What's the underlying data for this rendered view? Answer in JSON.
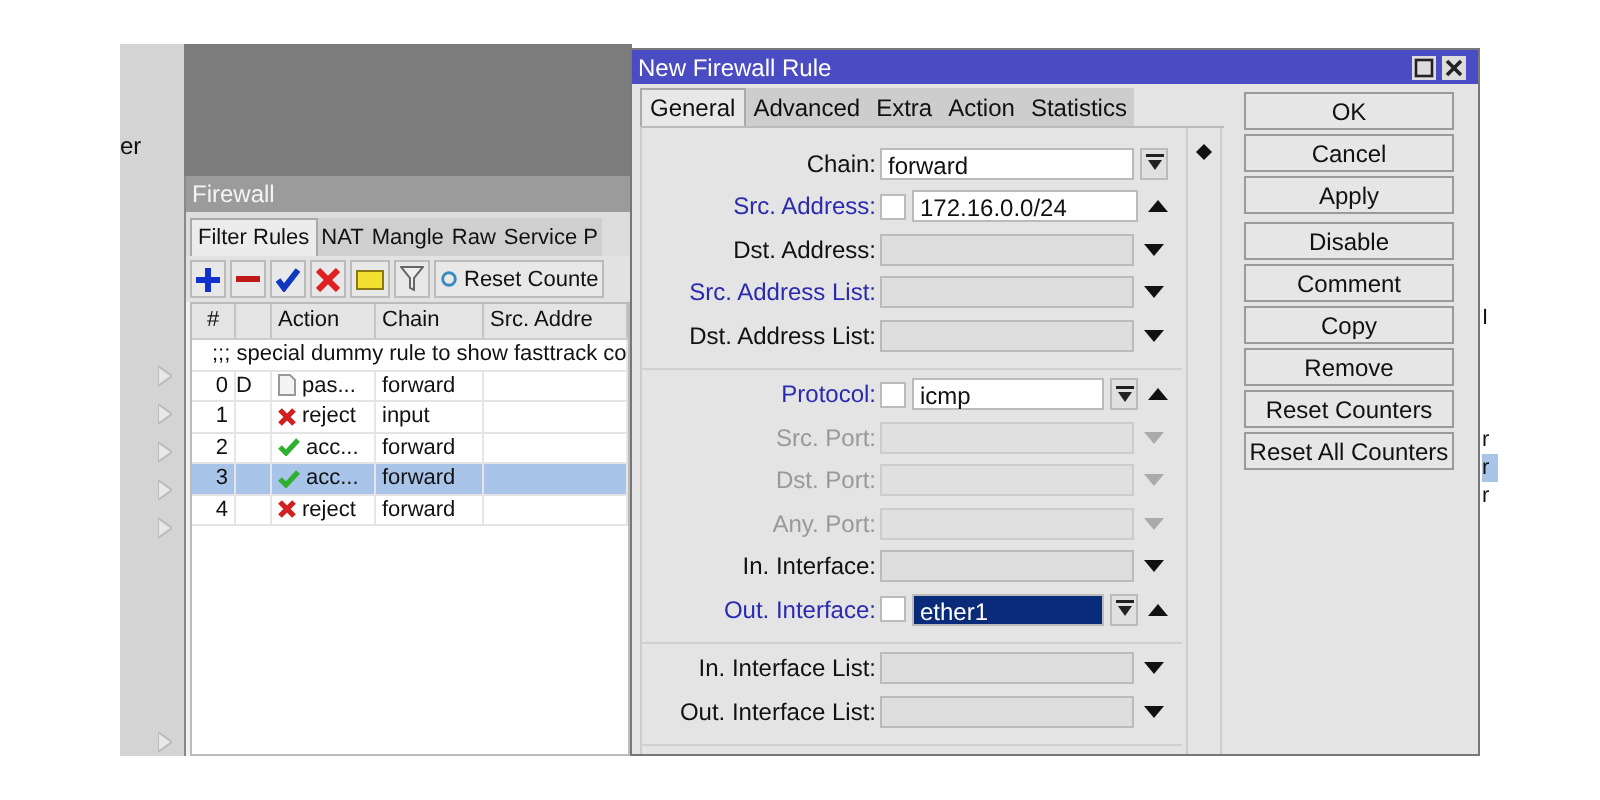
{
  "sidebar": {
    "label": "er"
  },
  "firewall": {
    "title": "Firewall",
    "tabs": [
      {
        "label": "Filter Rules",
        "selected": true
      },
      {
        "label": "NAT",
        "selected": false
      },
      {
        "label": "Mangle",
        "selected": false
      },
      {
        "label": "Raw",
        "selected": false
      },
      {
        "label": "Service P",
        "selected": false
      }
    ],
    "reset_button": "Reset Counte",
    "columns": [
      "#",
      "Action",
      "Chain",
      "Src. Addre"
    ],
    "rows": [
      {
        "kind": "comment",
        "text": ";;; special dummy rule to show fasttrack co"
      },
      {
        "kind": "passthrough",
        "number": "0",
        "flag": "D",
        "action": "pas...",
        "chain": "forward",
        "selected": false
      },
      {
        "kind": "reject",
        "number": "1",
        "action": "reject",
        "chain": "input",
        "selected": false
      },
      {
        "kind": "accept",
        "number": "2",
        "action": "acc...",
        "chain": "forward",
        "selected": false
      },
      {
        "kind": "accept",
        "number": "3",
        "action": "acc...",
        "chain": "forward",
        "selected": true
      },
      {
        "kind": "reject",
        "number": "4",
        "action": "reject",
        "chain": "forward",
        "selected": false
      }
    ]
  },
  "dialog": {
    "title": "New Firewall Rule",
    "tabs": [
      {
        "label": "General",
        "selected": true
      },
      {
        "label": "Advanced",
        "selected": false
      },
      {
        "label": "Extra",
        "selected": false
      },
      {
        "label": "Action",
        "selected": false
      },
      {
        "label": "Statistics",
        "selected": false
      }
    ],
    "groups": [
      [
        {
          "label": "Chain:",
          "link": false,
          "disabled": false,
          "value": "forward",
          "highlighted": false,
          "dropdown": true
        },
        {
          "label": "Src. Address:",
          "link": true,
          "disabled": false,
          "negate": false,
          "value": "172.16.0.0/24",
          "highlighted": false,
          "dropdown": false,
          "expanded": true
        },
        {
          "label": "Dst. Address:",
          "link": false,
          "disabled": false,
          "dropdown": false,
          "expanded": false
        },
        {
          "label": "Src. Address List:",
          "link": true,
          "disabled": false,
          "dropdown": false,
          "expanded": false
        },
        {
          "label": "Dst. Address List:",
          "link": false,
          "disabled": false,
          "dropdown": false,
          "expanded": false
        }
      ],
      [
        {
          "label": "Protocol:",
          "link": true,
          "disabled": false,
          "negate": false,
          "value": "icmp",
          "highlighted": false,
          "dropdown": true,
          "expanded": true
        },
        {
          "label": "Src. Port:",
          "link": false,
          "disabled": true,
          "dropdown": false,
          "expanded": false
        },
        {
          "label": "Dst. Port:",
          "link": false,
          "disabled": true,
          "dropdown": false,
          "expanded": false
        },
        {
          "label": "Any. Port:",
          "link": false,
          "disabled": true,
          "dropdown": false,
          "expanded": false
        },
        {
          "label": "In. Interface:",
          "link": false,
          "disabled": false,
          "dropdown": false,
          "expanded": false
        },
        {
          "label": "Out. Interface:",
          "link": true,
          "disabled": false,
          "negate": false,
          "value": "ether1",
          "highlighted": true,
          "dropdown": true,
          "expanded": true
        }
      ],
      [
        {
          "label": "In. Interface List:",
          "link": false,
          "disabled": false,
          "dropdown": false,
          "expanded": false
        },
        {
          "label": "Out. Interface List:",
          "link": false,
          "disabled": false,
          "dropdown": false,
          "expanded": false
        }
      ]
    ],
    "buttons": [
      [
        "OK",
        "Cancel",
        "Apply"
      ],
      [
        "Disable",
        "Comment",
        "Copy",
        "Remove",
        "Reset Counters",
        "Reset All Counters"
      ]
    ]
  },
  "behind_window": {
    "texts": [
      {
        "text": "I",
        "selected": false
      },
      {
        "text": "r",
        "selected": false
      },
      {
        "text": "r",
        "selected": true
      },
      {
        "text": "r",
        "selected": false
      }
    ]
  }
}
